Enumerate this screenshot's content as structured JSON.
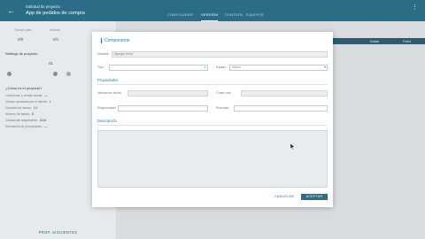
{
  "header": {
    "subtitle": "Solicitud de proyecto",
    "title": "App de pedidos de compra",
    "tabs": [
      {
        "label": "CONFIGURAR"
      },
      {
        "label": "VERSIÓN"
      },
      {
        "label": "CONTROL"
      },
      {
        "label": "EQUIPOS"
      }
    ],
    "active_tab": 1
  },
  "left_panel": {
    "stats": [
      {
        "label": "Tiempo plan",
        "value": "0/0"
      },
      {
        "label": "Activos",
        "value": "0/1"
      }
    ],
    "settings_title": "Settings de proyecto",
    "settings_value": "01",
    "info_title": "¿Cómo es el proyecto?",
    "info_lines": [
      {
        "label": "Línea base y versión actual:",
        "value": "—"
      },
      {
        "label": "Versión aprobada por el cliente:",
        "value": "1"
      },
      {
        "label": "Duración de tareas:",
        "value": "1.0"
      },
      {
        "label": "Número de tareas:",
        "value": "8"
      },
      {
        "label": "Calidad del seguimiento:",
        "value": "6/16"
      },
      {
        "label": "Desviación de presupuesto:",
        "value": "—"
      }
    ],
    "footer_button": "PROP. SIGUIENTES"
  },
  "table_header": {
    "columns": [
      "",
      "Estado",
      "Fecha"
    ]
  },
  "modal": {
    "title": "Componente",
    "fields": {
      "name_label": "Nombre",
      "name_value": "Agregar tarea",
      "type_label": "Tipo",
      "type_value": "",
      "state_label": "Estado",
      "state_value": "Nuevo",
      "section_properties": "Propiedades",
      "contract_label": "Valoración inicial",
      "contract_value": "",
      "cost_label": "Coste real",
      "cost_value": "",
      "responsible_label": "Responsable",
      "responsible_value": "",
      "priority_label": "Prioridad",
      "priority_value": "",
      "section_description": "Descripción"
    },
    "cancel_label": "CANCELAR",
    "accept_label": "ACEPTAR"
  }
}
